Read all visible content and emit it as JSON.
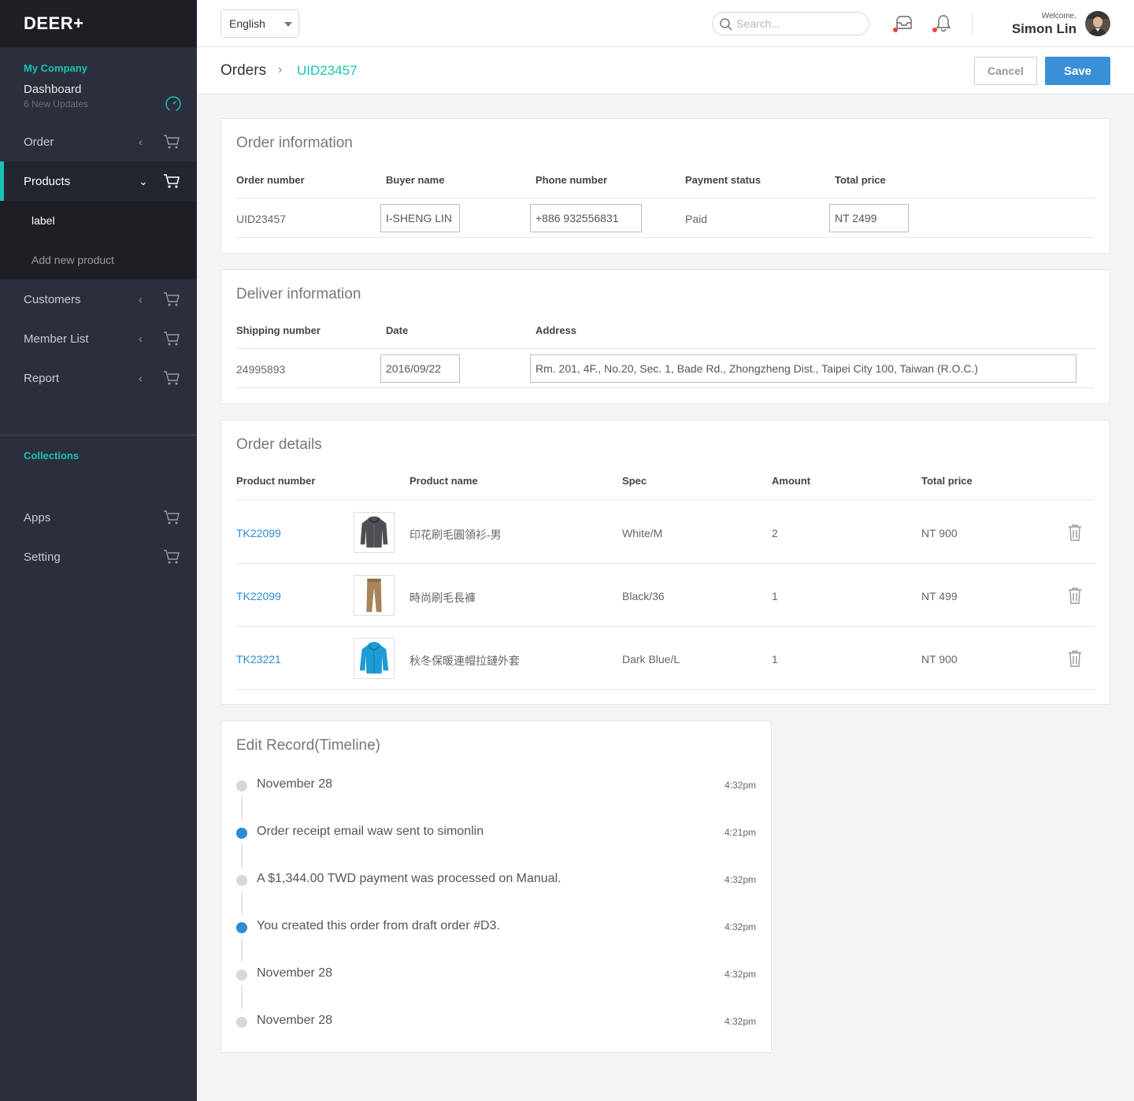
{
  "app": {
    "logo": "DEER+"
  },
  "sidebar": {
    "company_label": "My Company",
    "dashboard": {
      "label": "Dashboard",
      "sub": "6 New Updates"
    },
    "items": [
      {
        "label": "Order"
      },
      {
        "label": "Products"
      },
      {
        "label": "Customers"
      },
      {
        "label": "Member List"
      },
      {
        "label": "Report"
      }
    ],
    "products_sub": [
      {
        "label": "label"
      },
      {
        "label": "Add new product"
      }
    ],
    "collections_label": "Collections",
    "bottom_items": [
      {
        "label": "Apps"
      },
      {
        "label": "Setting"
      }
    ]
  },
  "topbar": {
    "language": "English",
    "search_placeholder": "Search...",
    "welcome": "Welcome,",
    "user_name": "Simon Lin"
  },
  "header": {
    "crumb_root": "Orders",
    "crumb_sep": "›",
    "crumb_current": "UID23457",
    "cancel_label": "Cancel",
    "save_label": "Save"
  },
  "order_info": {
    "title": "Order information",
    "headers": [
      "Order number",
      "Buyer name",
      "Phone number",
      "Payment status",
      "Total price"
    ],
    "order_number": "UID23457",
    "buyer_name": "I-SHENG LIN",
    "phone": "+886 932556831",
    "payment_status": "Paid",
    "total_price": "NT 2499"
  },
  "deliver_info": {
    "title": "Deliver information",
    "headers": [
      "Shipping number",
      "Date",
      "Address"
    ],
    "shipping_number": "24995893",
    "date": "2016/09/22",
    "address": "Rm. 201, 4F., No.20, Sec. 1, Bade Rd., Zhongzheng Dist., Taipei City 100, Taiwan (R.O.C.)"
  },
  "order_details": {
    "title": "Order details",
    "headers": [
      "Product number",
      "Product name",
      "Spec",
      "Amount",
      "Total price"
    ],
    "rows": [
      {
        "number": "TK22099",
        "name": "印花刷毛圓領衫-男",
        "spec": "White/M",
        "amount": "2",
        "total": "NT 900",
        "thumb": "hoodie-gray"
      },
      {
        "number": "TK22099",
        "name": "時尚刷毛長褲",
        "spec": "Black/36",
        "amount": "1",
        "total": "NT 499",
        "thumb": "pants-khaki"
      },
      {
        "number": "TK23221",
        "name": "秋冬保暖連帽拉鏈外套",
        "spec": "Dark Blue/L",
        "amount": "1",
        "total": "NT 900",
        "thumb": "hoodie-blue"
      }
    ]
  },
  "timeline": {
    "title": "Edit Record(Timeline)",
    "items": [
      {
        "text": "November 28",
        "time": "4:32pm",
        "color": "gray"
      },
      {
        "text": "Order receipt email waw sent to simonlin",
        "time": "4:21pm",
        "color": "blue"
      },
      {
        "text": "A $1,344.00 TWD payment was processed on Manual.",
        "time": "4:32pm",
        "color": "gray"
      },
      {
        "text": "You created this order from draft order #D3.",
        "time": "4:32pm",
        "color": "blue"
      },
      {
        "text": "November 28",
        "time": "4:32pm",
        "color": "gray"
      },
      {
        "text": "November 28",
        "time": "4:32pm",
        "color": "gray"
      }
    ]
  },
  "colors": {
    "accent": "#18c3b0",
    "primary": "#3a90d6",
    "sidebar": "#2b2f3b",
    "alert": "#e8453c"
  }
}
